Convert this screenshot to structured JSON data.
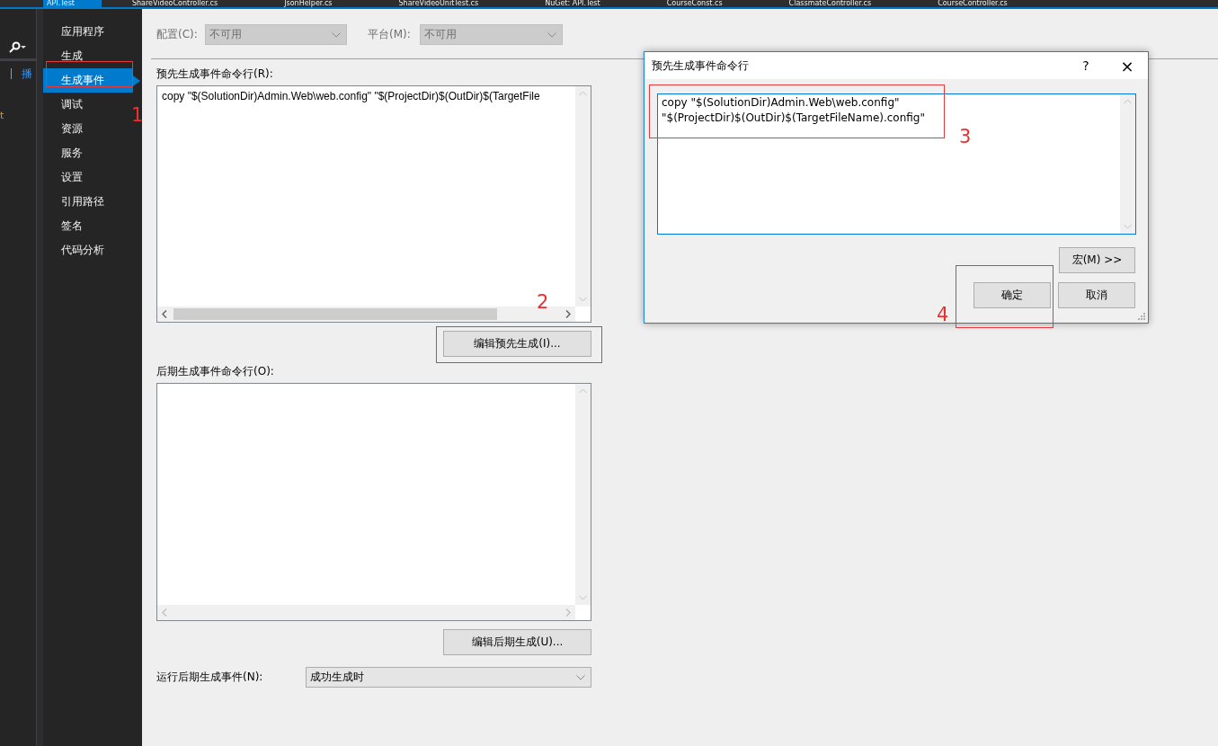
{
  "doc_tabs": [
    {
      "label": "API.Test",
      "selected": true
    },
    {
      "label": "ShareVideoController.cs",
      "selected": false
    },
    {
      "label": "JsonHelper.cs",
      "selected": false
    },
    {
      "label": "ShareVideoUnitTest.cs",
      "selected": false
    },
    {
      "label": "NuGet: API.Test",
      "selected": false
    },
    {
      "label": "CourseConst.cs",
      "selected": false
    },
    {
      "label": "ClassmateController.cs",
      "selected": false
    },
    {
      "label": "CourseController.cs",
      "selected": false
    }
  ],
  "tool_panel": {
    "tab_fragment": "播",
    "item_fragment": "t"
  },
  "sidebar": {
    "items": [
      {
        "label": "应用程序",
        "selected": false
      },
      {
        "label": "生成",
        "selected": false
      },
      {
        "label": "生成事件",
        "selected": true
      },
      {
        "label": "调试",
        "selected": false
      },
      {
        "label": "资源",
        "selected": false
      },
      {
        "label": "服务",
        "selected": false
      },
      {
        "label": "设置",
        "selected": false
      },
      {
        "label": "引用路径",
        "selected": false
      },
      {
        "label": "签名",
        "selected": false
      },
      {
        "label": "代码分析",
        "selected": false
      }
    ]
  },
  "config": [
    {
      "label": "配置(C):",
      "value": "不可用",
      "disabled": true
    },
    {
      "label": "平台(M):",
      "value": "不可用",
      "disabled": true
    }
  ],
  "pre_build": {
    "label": "预先生成事件命令行(R):",
    "value": "copy \"$(SolutionDir)Admin.Web\\web.config\" \"$(ProjectDir)$(OutDir)$(TargetFile",
    "button": "编辑预先生成(I)..."
  },
  "post_build": {
    "label": "后期生成事件命令行(O):",
    "button": "编辑后期生成(U)..."
  },
  "run_post_build": {
    "label": "运行后期生成事件(N):",
    "value": "成功生成时"
  },
  "dialog": {
    "title": "预先生成事件命令行",
    "help": "?",
    "close": "×",
    "lines": [
      "copy \"$(SolutionDir)Admin.Web\\web.config\"",
      "\"$(ProjectDir)$(OutDir)$(TargetFileName).config\""
    ],
    "buttons": [
      "宏(M) >>",
      "确定",
      "取消"
    ]
  },
  "annotations": [
    {
      "number": "1"
    },
    {
      "number": "2"
    },
    {
      "number": "3"
    },
    {
      "number": "4"
    }
  ]
}
